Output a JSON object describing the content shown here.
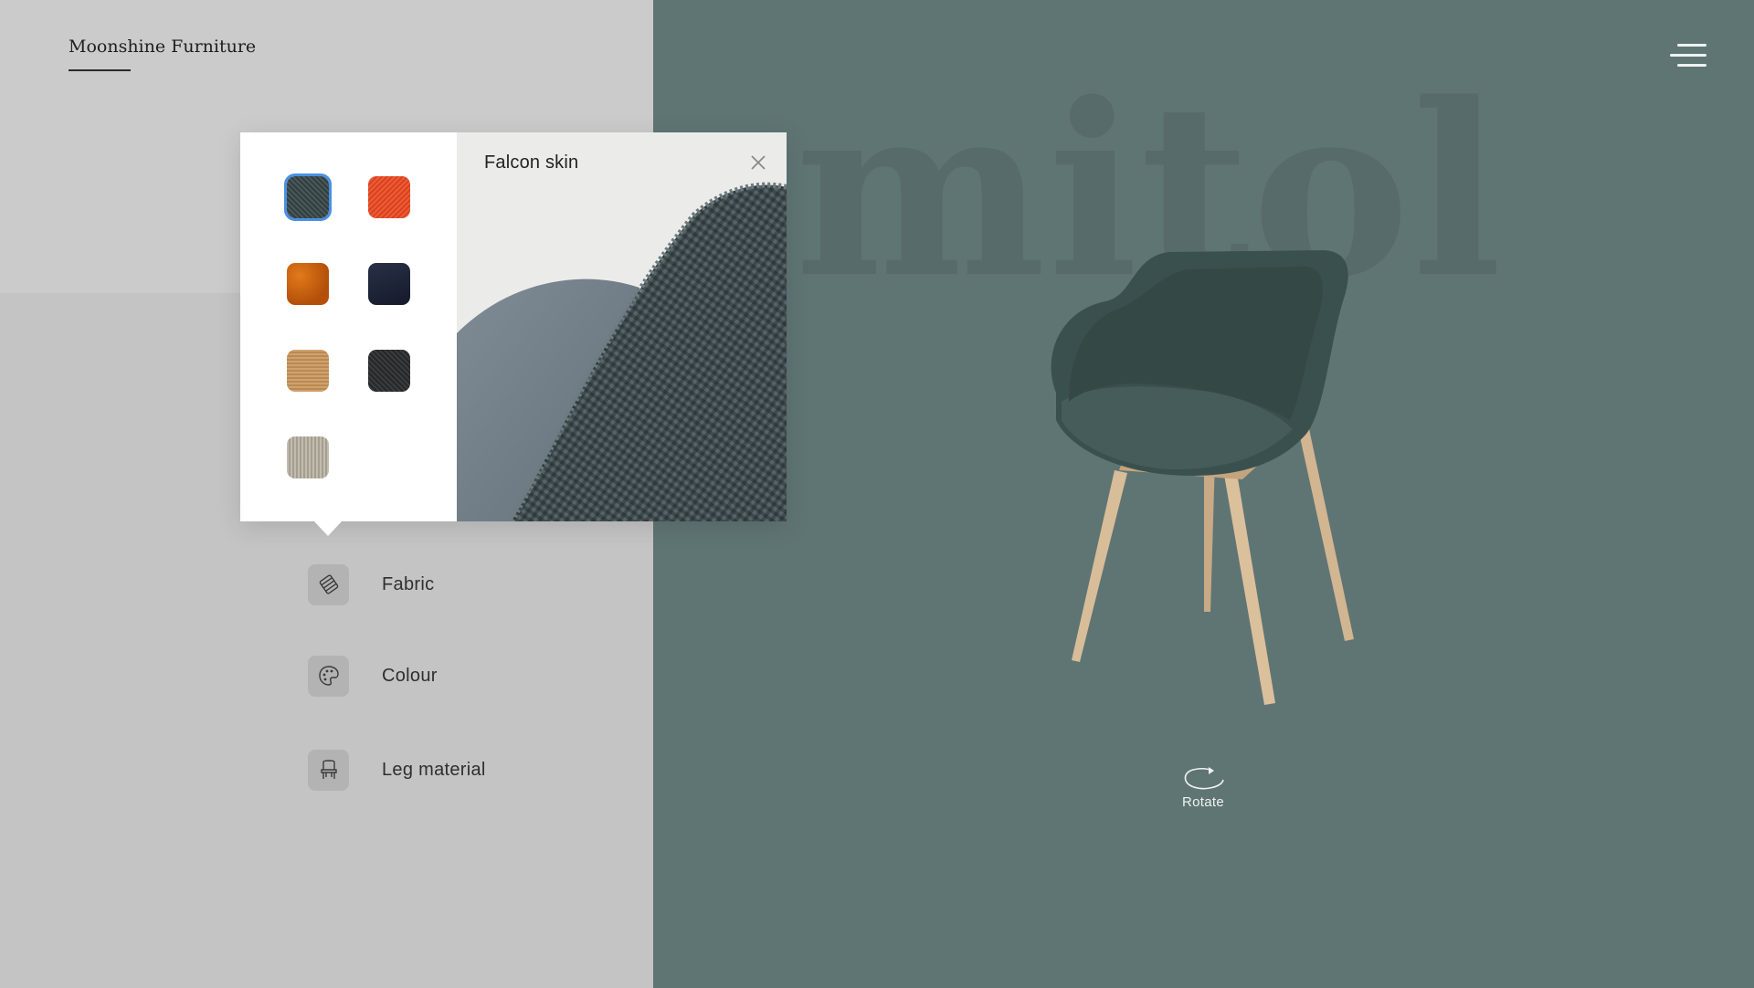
{
  "header": {
    "brand": "Moonshine Furniture",
    "menu_icon": "hamburger-menu-icon"
  },
  "background_word": "mitol",
  "fabric_popup": {
    "selected_name": "Falcon skin",
    "close_icon": "close-icon",
    "swatches": [
      {
        "color": "#3d4a4c",
        "selected": true
      },
      {
        "color": "#e8512f",
        "selected": false
      },
      {
        "color": "#c85a0e",
        "selected": false
      },
      {
        "color": "#1f2538",
        "selected": false
      },
      {
        "color": "#c79a63",
        "selected": false
      },
      {
        "color": "#303234",
        "selected": false
      },
      {
        "color": "#b5afa1",
        "selected": false
      }
    ]
  },
  "options": [
    {
      "label": "Fabric",
      "icon": "fabric-icon"
    },
    {
      "label": "Colour",
      "icon": "palette-icon"
    },
    {
      "label": "Leg material",
      "icon": "chair-icon"
    }
  ],
  "rotate": {
    "label": "Rotate",
    "icon": "rotate-icon"
  },
  "colors": {
    "left_panel": "#c4c4c4",
    "right_panel": "#5f7574",
    "accent_selected": "#4a90e2",
    "chair_fabric": "#3a504e",
    "chair_legs": "#d2b591"
  }
}
